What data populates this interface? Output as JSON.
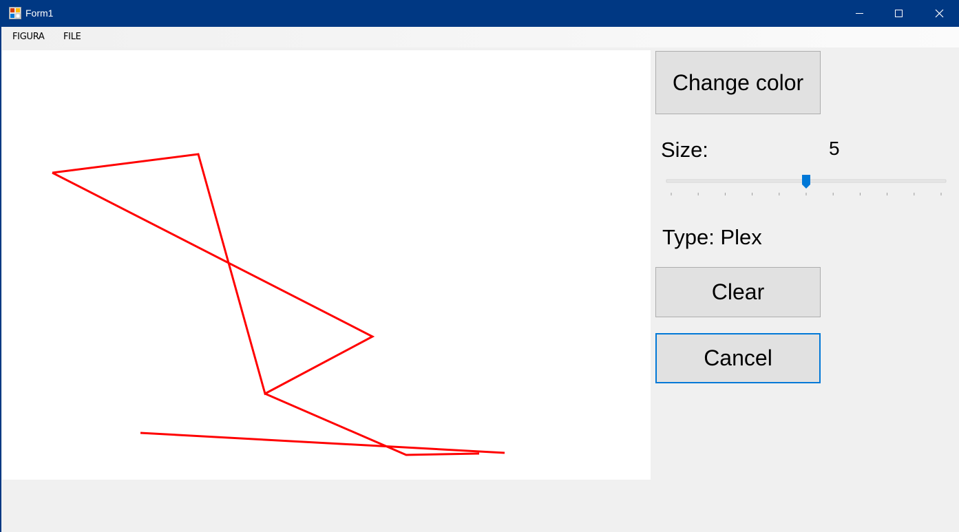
{
  "window": {
    "title": "Form1"
  },
  "menu": {
    "items": [
      "FIGURA",
      "FILE"
    ]
  },
  "controls": {
    "change_color_label": "Change color",
    "size_label": "Size:",
    "size_value": "5",
    "size_slider": {
      "min": 0,
      "max": 10,
      "value": 5
    },
    "type_label": "Type: Plex",
    "clear_label": "Clear",
    "cancel_label": "Cancel"
  },
  "drawing": {
    "stroke_color": "#ff0000"
  },
  "colors": {
    "titlebar": "#003883",
    "accent": "#0078d7",
    "button_face": "#e1e1e1"
  }
}
